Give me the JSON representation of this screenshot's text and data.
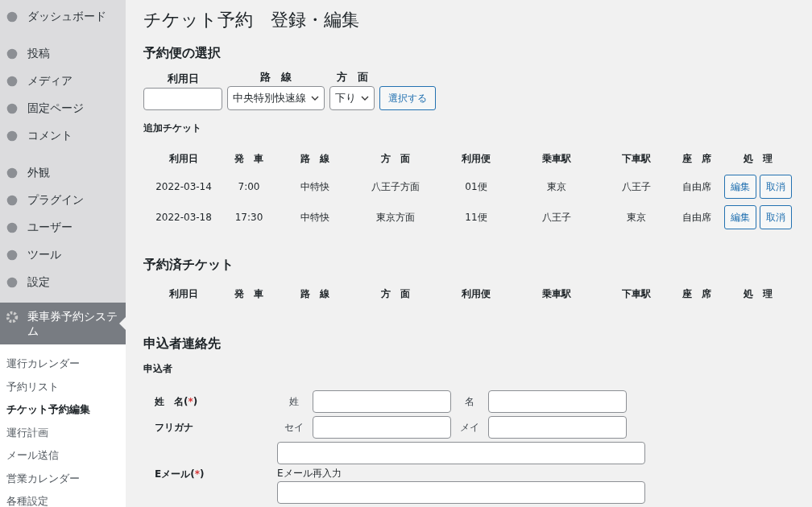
{
  "sidebar": {
    "groups": [
      {
        "items": [
          {
            "label": "ダッシュボード"
          }
        ]
      },
      {
        "items": [
          {
            "label": "投稿"
          },
          {
            "label": "メディア"
          },
          {
            "label": "固定ページ"
          },
          {
            "label": "コメント"
          }
        ]
      },
      {
        "items": [
          {
            "label": "外観"
          },
          {
            "label": "プラグイン"
          },
          {
            "label": "ユーザー"
          },
          {
            "label": "ツール"
          },
          {
            "label": "設定"
          }
        ]
      }
    ],
    "active": {
      "label": "乗車券予約システム"
    },
    "submenu": [
      {
        "label": "運行カレンダー",
        "selected": false
      },
      {
        "label": "予約リスト",
        "selected": false
      },
      {
        "label": "チケット予約編集",
        "selected": true
      },
      {
        "label": "運行計画",
        "selected": false
      },
      {
        "label": "メール送信",
        "selected": false
      },
      {
        "label": "営業カレンダー",
        "selected": false
      },
      {
        "label": "各種設定",
        "selected": false
      }
    ]
  },
  "page_title": "チケット予約　登録・編集",
  "selection": {
    "heading": "予約便の選択",
    "date_label": "利用日",
    "route_label": "路　線",
    "route_value": "中央特別快速線",
    "direction_label": "方　面",
    "direction_value": "下り",
    "button": "選択する"
  },
  "added": {
    "heading": "追加チケット",
    "columns": [
      "利用日",
      "発　車",
      "路　線",
      "方　面",
      "利用便",
      "乗車駅",
      "下車駅",
      "座　席",
      "処　理"
    ],
    "rows": [
      {
        "cells": [
          "2022-03-14",
          "7:00",
          "中特快",
          "八王子方面",
          "01便",
          "東京",
          "八王子",
          "自由席"
        ],
        "actions": [
          "編集",
          "取消"
        ]
      },
      {
        "cells": [
          "2022-03-18",
          "17:30",
          "中特快",
          "東京方面",
          "11便",
          "八王子",
          "東京",
          "自由席"
        ],
        "actions": [
          "編集",
          "取消"
        ]
      }
    ]
  },
  "booked": {
    "heading": "予約済チケット",
    "columns": [
      "利用日",
      "発　車",
      "路　線",
      "方　面",
      "利用便",
      "乗車駅",
      "下車駅",
      "座　席",
      "処　理"
    ]
  },
  "contact": {
    "heading": "申込者連絡先",
    "subheading": "申込者",
    "name": {
      "label": "姓　名",
      "required": {
        "open": "(",
        "mark": "*",
        "close": ")"
      },
      "first_label": "姓",
      "second_label": "名"
    },
    "kana": {
      "label": "フリガナ",
      "first_label": "セイ",
      "second_label": "メイ"
    },
    "email": {
      "label": "Eメール",
      "required": {
        "open": "(",
        "mark": "*",
        "close": ")"
      },
      "confirm_label": "Eメール再入力"
    }
  }
}
